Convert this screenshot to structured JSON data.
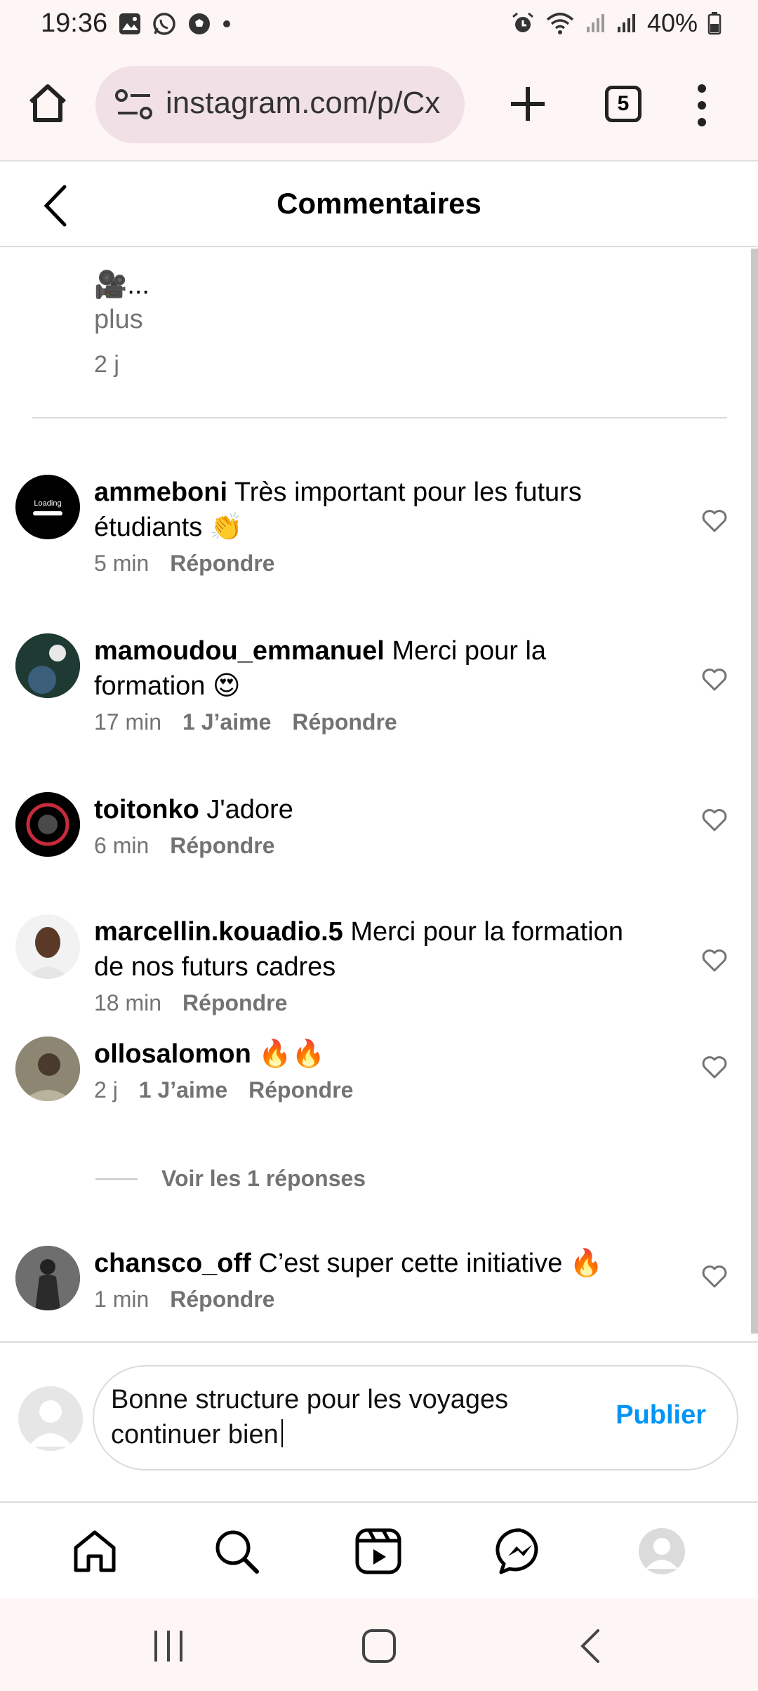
{
  "status_bar": {
    "time": "19:36",
    "left_icons": [
      "gallery-icon",
      "whatsapp-icon",
      "soccer-ball-icon",
      "dot-icon"
    ],
    "right_icons": [
      "alarm-icon",
      "wifi-icon",
      "signal-icon",
      "signal-icon"
    ],
    "battery": "40%"
  },
  "browser": {
    "url": "instagram.com/p/Cx",
    "tab_count": "5"
  },
  "header": {
    "title": "Commentaires"
  },
  "caption": {
    "text": "🎥...",
    "more": "plus",
    "time": "2 j"
  },
  "comments": [
    {
      "username": "ammeboni",
      "text": "Très important pour les futurs étudiants 👏",
      "time": "5 min",
      "likes": "",
      "reply": "Répondre"
    },
    {
      "username": "mamoudou_emmanuel",
      "text": "Merci pour la formation 😍",
      "time": "17 min",
      "likes": "1 J’aime",
      "reply": "Répondre"
    },
    {
      "username": "toitonko",
      "text": "J'adore",
      "time": "6 min",
      "likes": "",
      "reply": "Répondre"
    },
    {
      "username": "marcellin.kouadio.5",
      "text": "Merci pour la formation de nos futurs cadres",
      "time": "18 min",
      "likes": "",
      "reply": "Répondre"
    },
    {
      "username": "ollosalomon",
      "text": "🔥🔥",
      "time": "2 j",
      "likes": "1 J’aime",
      "reply": "Répondre"
    },
    {
      "username": "chansco_off",
      "text": "C’est super cette initiative 🔥",
      "time": "1 min",
      "likes": "",
      "reply": "Répondre"
    }
  ],
  "avatar_1_text": "Loading",
  "view_replies": "Voir les 1 réponses",
  "compose": {
    "text": "Bonne structure pour les voyages continuer bien",
    "publish": "Publier"
  },
  "colors": {
    "accent": "#0095f6",
    "muted": "#737373",
    "chrome_bg": "#fdf6f5",
    "url_bg": "#f1e1e7"
  }
}
